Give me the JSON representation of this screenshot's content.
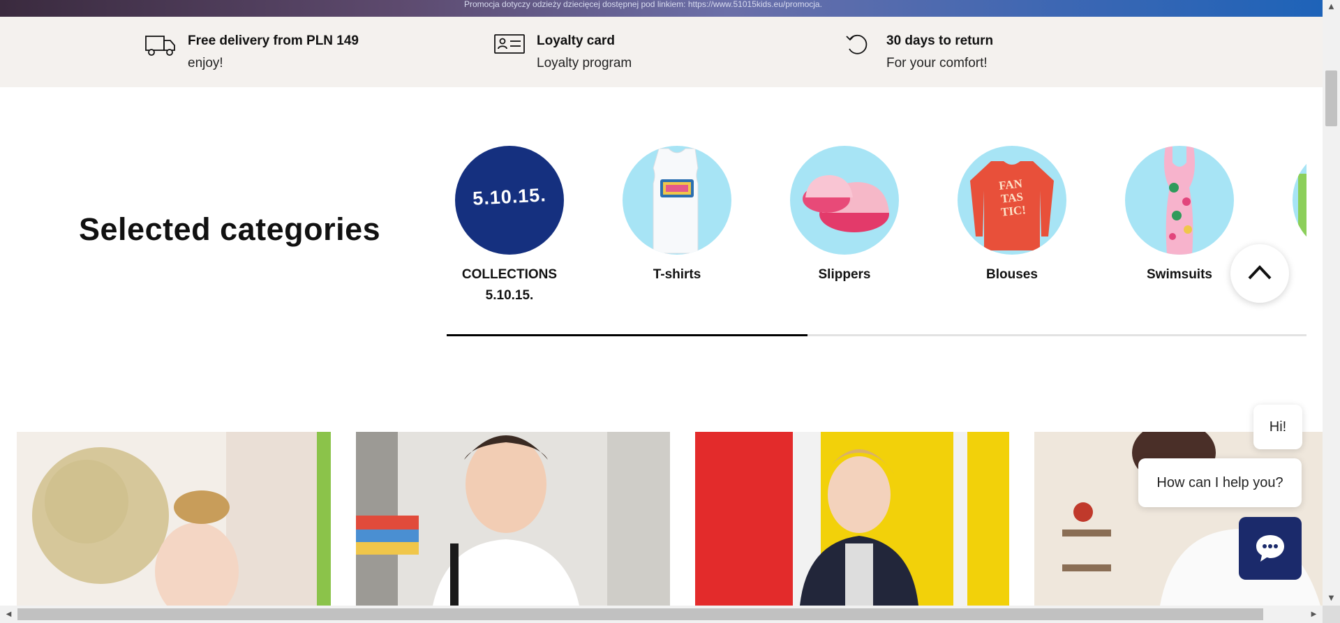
{
  "promo": {
    "text": "Promocja dotyczy odzieży dziecięcej dostępnej pod linkiem: https://www.51015kids.eu/promocja."
  },
  "benefits": [
    {
      "icon": "truck-icon",
      "title": "Free delivery from PLN 149",
      "subtitle": "enjoy!"
    },
    {
      "icon": "loyalty-card-icon",
      "title": "Loyalty card",
      "subtitle": "Loyalty program"
    },
    {
      "icon": "return-arrow-icon",
      "title": "30 days to return",
      "subtitle": "For your comfort!"
    }
  ],
  "categories_section": {
    "title": "Selected categories",
    "items": [
      {
        "label": "COLLECTIONS 5.10.15.",
        "image": "5.10.15.",
        "icon": "collections-logo"
      },
      {
        "label": "T-shirts",
        "icon": "tshirt-image"
      },
      {
        "label": "Slippers",
        "icon": "slippers-image"
      },
      {
        "label": "Blouses",
        "icon": "blouse-image",
        "image_text": "FAN TAS TIC!"
      },
      {
        "label": "Swimsuits",
        "icon": "swimsuit-image"
      }
    ],
    "scroll_progress": 0.42
  },
  "scroll_top": {
    "icon": "chevron-up-icon"
  },
  "tiles": [
    {
      "name": "girl-with-globe"
    },
    {
      "name": "boy-with-backpack"
    },
    {
      "name": "girl-at-lockers"
    },
    {
      "name": "boy-with-cap"
    }
  ],
  "chat": {
    "greeting": "Hi!",
    "question": "How can I help you?",
    "button_icon": "chat-icon"
  },
  "colors": {
    "navy": "#1b2a6b",
    "collections_blue": "#15307f",
    "category_bg": "#a7e4f5",
    "benefits_bg": "#f4f1ee"
  }
}
